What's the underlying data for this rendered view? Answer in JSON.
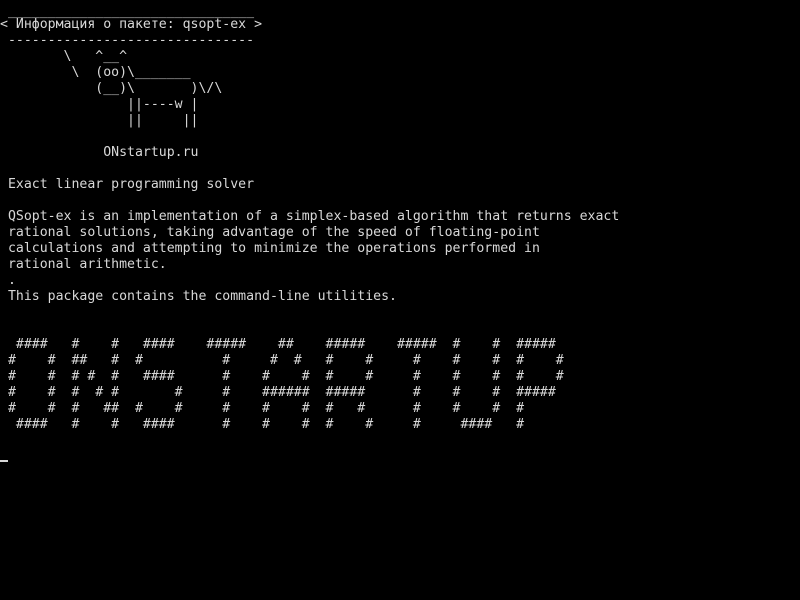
{
  "terminal": {
    "bubble_top": " _______________________________",
    "bubble_title": "< Информация о пакете: qsopt-ex >",
    "bubble_bottom": " -------------------------------",
    "cow": [
      "        \\   ^__^",
      "         \\  (oo)\\_______",
      "            (__)\\       )\\/\\",
      "                ||----w |",
      "                ||     ||"
    ],
    "site": "             ONstartup.ru",
    "summary": " Exact linear programming solver",
    "description": [
      " QSopt-ex is an implementation of a simplex-based algorithm that returns exact",
      " rational solutions, taking advantage of the speed of floating-point",
      " calculations and attempting to minimize the operations performed in",
      " rational arithmetic.",
      " .",
      " This package contains the command-line utilities."
    ],
    "banner": [
      "  ####   #    #   ####    #####    ##    #####    #####  #    #  #####",
      " #    #  ##   #  #          #     #  #   #    #     #    #    #  #    #",
      " #    #  # #  #   ####      #    #    #  #    #     #    #    #  #    #",
      " #    #  #  # #       #     #    ######  #####      #    #    #  #####",
      " #    #  #   ##  #    #     #    #    #  #   #      #    #    #  #",
      "  ####   #    #   ####      #    #    #  #    #     #     ####   #"
    ]
  }
}
